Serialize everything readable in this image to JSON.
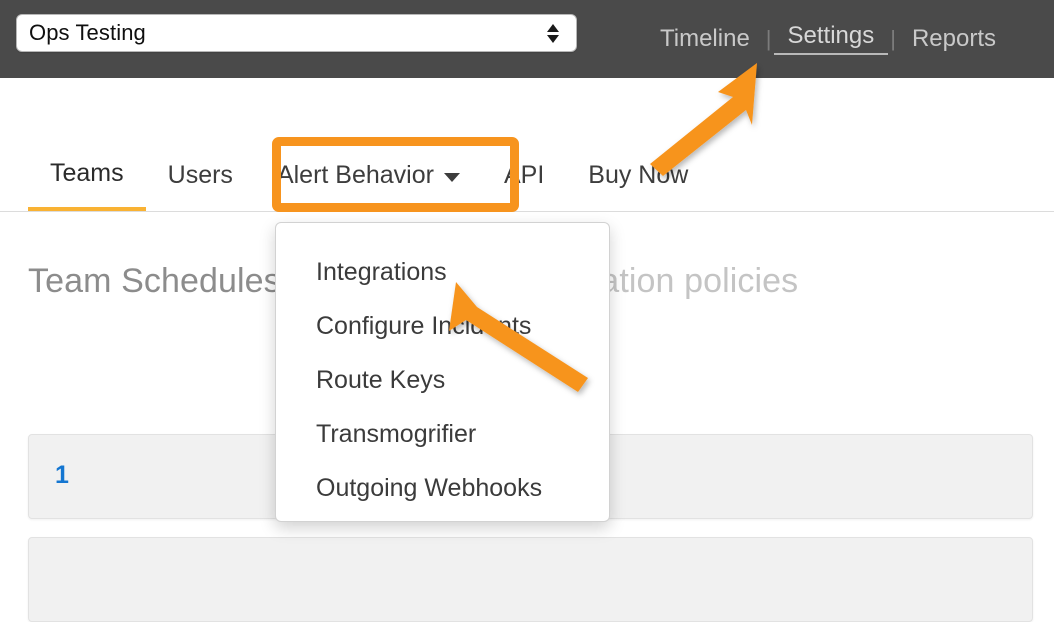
{
  "header": {
    "team_select": {
      "value": "Ops Testing",
      "stepper_icon": "stepper-up-down-icon"
    },
    "nav": [
      {
        "label": "Timeline",
        "active": false
      },
      {
        "label": "Settings",
        "active": true
      },
      {
        "label": "Reports",
        "active": false
      }
    ],
    "separator": "|",
    "background_color": "#4a4a4a"
  },
  "tabs": [
    {
      "label": "Teams",
      "active": true,
      "has_caret": false
    },
    {
      "label": "Users",
      "active": false,
      "has_caret": false
    },
    {
      "label": "Alert Behavior",
      "active": false,
      "has_caret": true,
      "highlighted": true
    },
    {
      "label": "API",
      "active": false,
      "has_caret": false
    },
    {
      "label": "Buy Now",
      "active": false,
      "has_caret": false
    }
  ],
  "dropdown": {
    "open": true,
    "items": [
      {
        "label": "Integrations"
      },
      {
        "label": "Configure Incidents"
      },
      {
        "label": "Route Keys"
      },
      {
        "label": "Transmogrifier"
      },
      {
        "label": "Outgoing Webhooks"
      }
    ]
  },
  "page": {
    "heading": "Team Schedules",
    "subheading": "schedules and escalation policies"
  },
  "cards": [
    {
      "index": "1"
    },
    {
      "index": ""
    }
  ],
  "annotations": {
    "accent_color": "#f7941e",
    "arrow_to_settings": "orange-arrow-icon",
    "arrow_to_integrations": "orange-arrow-icon",
    "highlight_target": "Alert Behavior"
  },
  "colors": {
    "accent_orange": "#f7941e",
    "active_tab_underline": "#f9b233",
    "link_blue": "#1476d1",
    "header_gray": "#4a4a4a",
    "card_gray": "#f1f1f1"
  }
}
